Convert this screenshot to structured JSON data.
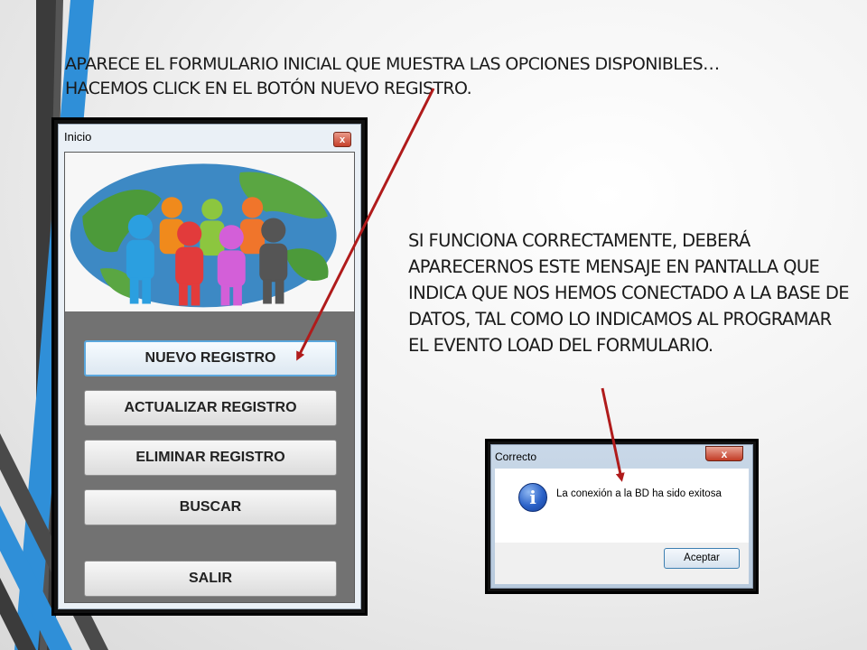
{
  "captions": {
    "top": "APARECE EL FORMULARIO INICIAL QUE MUESTRA LAS OPCIONES DISPONIBLES… HACEMOS CLICK EN EL BOTÓN NUEVO REGISTRO.",
    "right": "SI FUNCIONA CORRECTAMENTE, DEBERÁ APARECERNOS ESTE MENSAJE EN PANTALLA QUE INDICA QUE NOS HEMOS CONECTADO A LA BASE DE DATOS, TAL COMO LO INDICAMOS AL PROGRAMAR EL EVENTO LOAD DEL FORMULARIO."
  },
  "inicio_window": {
    "title": "Inicio",
    "close_glyph": "x",
    "buttons": {
      "nuevo": "NUEVO REGISTRO",
      "actualizar": "ACTUALIZAR REGISTRO",
      "eliminar": "ELIMINAR REGISTRO",
      "buscar": "BUSCAR",
      "salir": "SALIR"
    },
    "logo_icon": "globe-people-icon"
  },
  "dialog": {
    "title": "Correcto",
    "close_glyph": "x",
    "message": "La conexión a la BD ha sido exitosa",
    "accept_label": "Aceptar",
    "icon": "info-icon",
    "icon_glyph": "i"
  },
  "colors": {
    "arrow": "#b01b1b",
    "accent_blue": "#2f8fd8",
    "stripe_dark": "#3a3a3a"
  }
}
